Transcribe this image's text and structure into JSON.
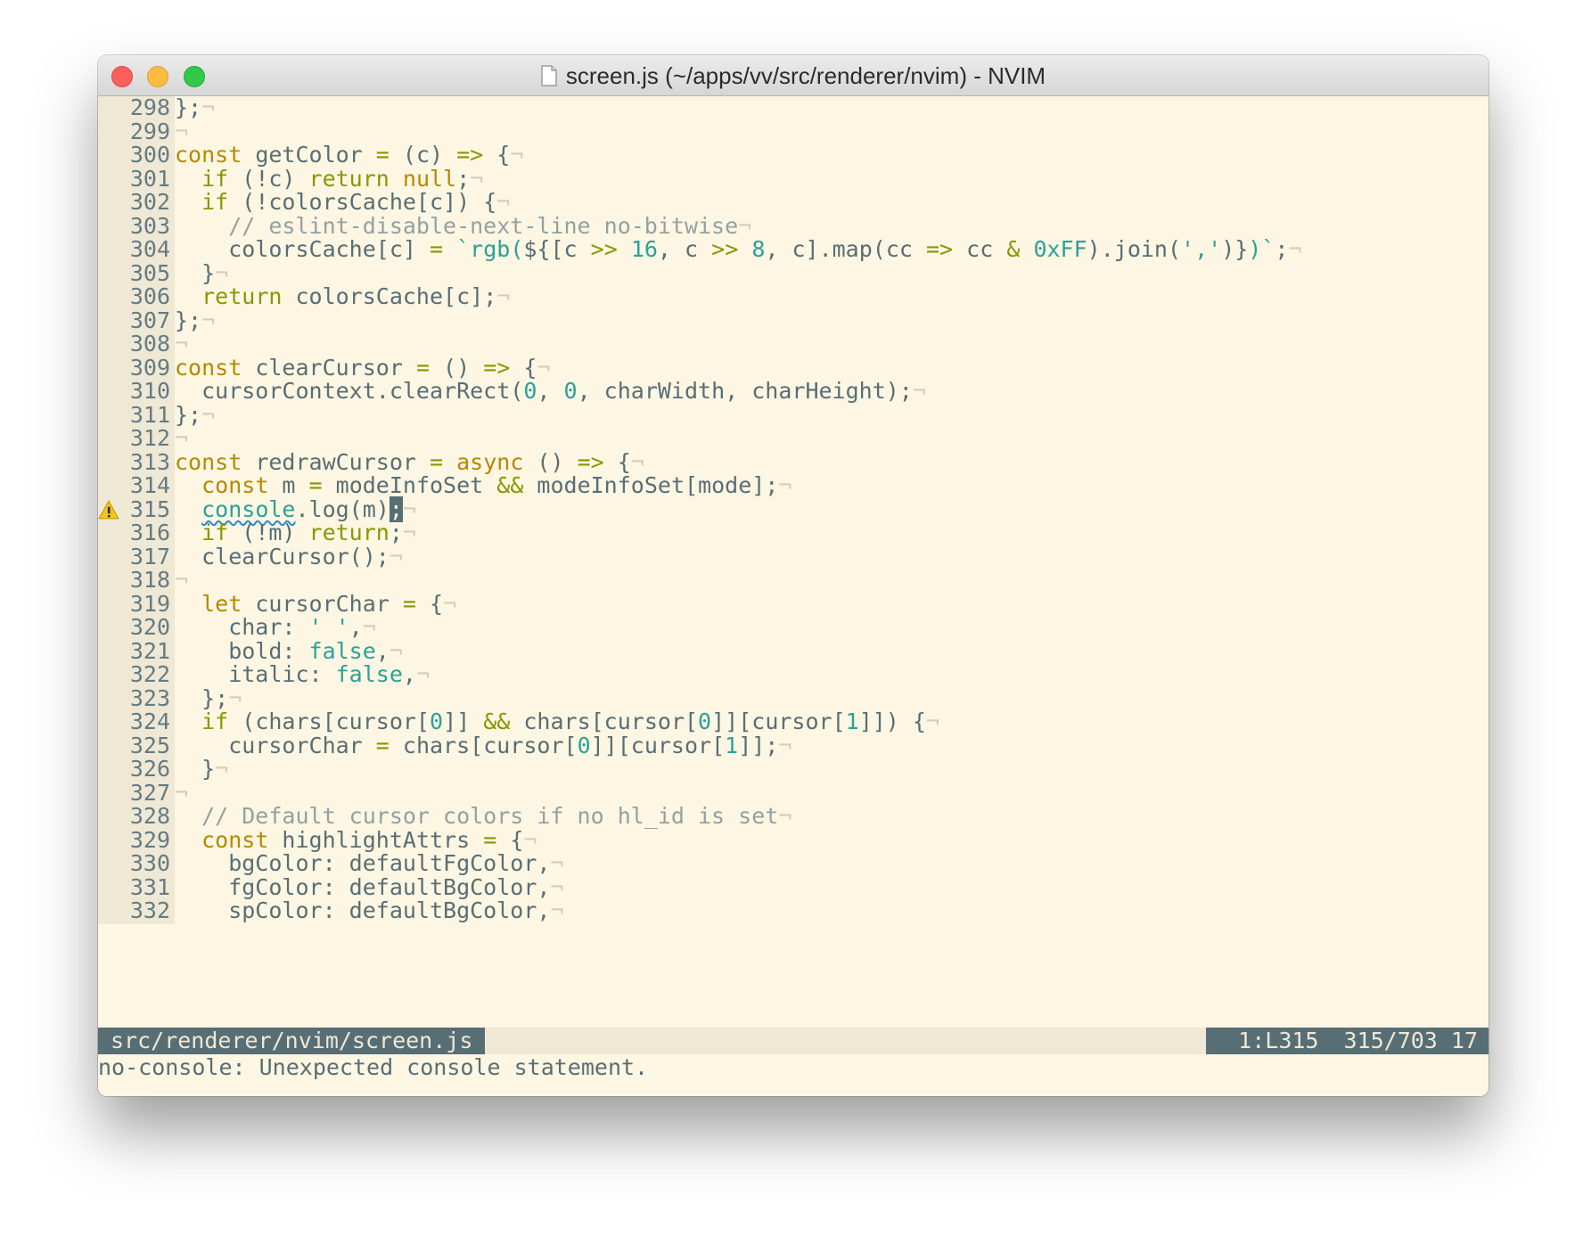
{
  "window": {
    "title": "screen.js (~/apps/vv/src/renderer/nvim) - NVIM"
  },
  "editor": {
    "eol_marker": "¬",
    "lines": [
      {
        "n": "298",
        "t": [
          [
            "};",
            ""
          ]
        ]
      },
      {
        "n": "299",
        "t": []
      },
      {
        "n": "300",
        "t": [
          [
            "const",
            "st"
          ],
          [
            " getColor ",
            ""
          ],
          [
            "=",
            "op"
          ],
          [
            " (c) ",
            ""
          ],
          [
            "=>",
            "op"
          ],
          [
            " {",
            ""
          ]
        ]
      },
      {
        "n": "301",
        "t": [
          [
            "  ",
            ""
          ],
          [
            "if",
            "kw"
          ],
          [
            " (!c) ",
            ""
          ],
          [
            "return",
            "kw"
          ],
          [
            " ",
            ""
          ],
          [
            "null",
            "st"
          ],
          [
            ";",
            ""
          ]
        ]
      },
      {
        "n": "302",
        "t": [
          [
            "  ",
            ""
          ],
          [
            "if",
            "kw"
          ],
          [
            " (!colorsCache[c]) {",
            ""
          ]
        ]
      },
      {
        "n": "303",
        "t": [
          [
            "    // eslint-disable-next-line no-bitwise",
            "cm"
          ]
        ]
      },
      {
        "n": "304",
        "t": [
          [
            "    colorsCache[c] ",
            ""
          ],
          [
            "=",
            "op"
          ],
          [
            " ",
            ""
          ],
          [
            "`rgb(",
            "str"
          ],
          [
            "${",
            ""
          ],
          [
            "[c ",
            ""
          ],
          [
            ">>",
            "op"
          ],
          [
            " ",
            ""
          ],
          [
            "16",
            "num"
          ],
          [
            ", c ",
            ""
          ],
          [
            ">>",
            "op"
          ],
          [
            " ",
            ""
          ],
          [
            "8",
            "num"
          ],
          [
            ", c].map(cc ",
            ""
          ],
          [
            "=>",
            "op"
          ],
          [
            " cc ",
            ""
          ],
          [
            "&",
            "op"
          ],
          [
            " ",
            ""
          ],
          [
            "0xFF",
            "num"
          ],
          [
            ").join(",
            ""
          ],
          [
            "','",
            "str"
          ],
          [
            ")}",
            ""
          ],
          [
            ")`",
            "str"
          ],
          [
            ";",
            ""
          ]
        ]
      },
      {
        "n": "305",
        "t": [
          [
            "  }",
            ""
          ]
        ]
      },
      {
        "n": "306",
        "t": [
          [
            "  ",
            ""
          ],
          [
            "return",
            "kw"
          ],
          [
            " colorsCache[c];",
            ""
          ]
        ]
      },
      {
        "n": "307",
        "t": [
          [
            "};",
            ""
          ]
        ]
      },
      {
        "n": "308",
        "t": []
      },
      {
        "n": "309",
        "t": [
          [
            "const",
            "st"
          ],
          [
            " clearCursor ",
            ""
          ],
          [
            "=",
            "op"
          ],
          [
            " () ",
            ""
          ],
          [
            "=>",
            "op"
          ],
          [
            " {",
            ""
          ]
        ]
      },
      {
        "n": "310",
        "t": [
          [
            "  cursorContext.clearRect(",
            ""
          ],
          [
            "0",
            "num"
          ],
          [
            ", ",
            ""
          ],
          [
            "0",
            "num"
          ],
          [
            ", charWidth, charHeight);",
            ""
          ]
        ]
      },
      {
        "n": "311",
        "t": [
          [
            "};",
            ""
          ]
        ]
      },
      {
        "n": "312",
        "t": []
      },
      {
        "n": "313",
        "t": [
          [
            "const",
            "st"
          ],
          [
            " redrawCursor ",
            ""
          ],
          [
            "=",
            "op"
          ],
          [
            " ",
            ""
          ],
          [
            "async",
            "st"
          ],
          [
            " () ",
            ""
          ],
          [
            "=>",
            "op"
          ],
          [
            " {",
            ""
          ]
        ]
      },
      {
        "n": "314",
        "t": [
          [
            "  ",
            ""
          ],
          [
            "const",
            "st"
          ],
          [
            " m ",
            ""
          ],
          [
            "=",
            "op"
          ],
          [
            " modeInfoSet ",
            ""
          ],
          [
            "&&",
            "op"
          ],
          [
            " modeInfoSet[mode];",
            ""
          ]
        ]
      },
      {
        "n": "315",
        "sign": "warning-sign",
        "t": [
          [
            "  ",
            ""
          ],
          [
            "console",
            "squig"
          ],
          [
            ".log(m)",
            ""
          ],
          [
            ";",
            "cursor"
          ]
        ]
      },
      {
        "n": "316",
        "t": [
          [
            "  ",
            ""
          ],
          [
            "if",
            "kw"
          ],
          [
            " (!m) ",
            ""
          ],
          [
            "return",
            "kw"
          ],
          [
            ";",
            ""
          ]
        ]
      },
      {
        "n": "317",
        "t": [
          [
            "  clearCursor();",
            ""
          ]
        ]
      },
      {
        "n": "318",
        "t": []
      },
      {
        "n": "319",
        "t": [
          [
            "  ",
            ""
          ],
          [
            "let",
            "st"
          ],
          [
            " cursorChar ",
            ""
          ],
          [
            "=",
            "op"
          ],
          [
            " {",
            ""
          ]
        ]
      },
      {
        "n": "320",
        "t": [
          [
            "    char: ",
            ""
          ],
          [
            "' '",
            "str"
          ],
          [
            ",",
            ""
          ]
        ]
      },
      {
        "n": "321",
        "t": [
          [
            "    bold: ",
            ""
          ],
          [
            "false",
            "bool"
          ],
          [
            ",",
            ""
          ]
        ]
      },
      {
        "n": "322",
        "t": [
          [
            "    italic: ",
            ""
          ],
          [
            "false",
            "bool"
          ],
          [
            ",",
            ""
          ]
        ]
      },
      {
        "n": "323",
        "t": [
          [
            "  };",
            ""
          ]
        ]
      },
      {
        "n": "324",
        "t": [
          [
            "  ",
            ""
          ],
          [
            "if",
            "kw"
          ],
          [
            " (chars[cursor[",
            ""
          ],
          [
            "0",
            "num"
          ],
          [
            "]] ",
            ""
          ],
          [
            "&&",
            "op"
          ],
          [
            " chars[cursor[",
            ""
          ],
          [
            "0",
            "num"
          ],
          [
            "]][cursor[",
            ""
          ],
          [
            "1",
            "num"
          ],
          [
            "]]) {",
            ""
          ]
        ]
      },
      {
        "n": "325",
        "t": [
          [
            "    cursorChar ",
            ""
          ],
          [
            "=",
            "op"
          ],
          [
            " chars[cursor[",
            ""
          ],
          [
            "0",
            "num"
          ],
          [
            "]][cursor[",
            ""
          ],
          [
            "1",
            "num"
          ],
          [
            "]];",
            ""
          ]
        ]
      },
      {
        "n": "326",
        "t": [
          [
            "  }",
            ""
          ]
        ]
      },
      {
        "n": "327",
        "t": []
      },
      {
        "n": "328",
        "t": [
          [
            "  // Default cursor colors if no hl_id is set",
            "cm"
          ]
        ]
      },
      {
        "n": "329",
        "t": [
          [
            "  ",
            ""
          ],
          [
            "const",
            "st"
          ],
          [
            " highlightAttrs ",
            ""
          ],
          [
            "=",
            "op"
          ],
          [
            " {",
            ""
          ]
        ]
      },
      {
        "n": "330",
        "t": [
          [
            "    bgColor: defaultFgColor,",
            ""
          ]
        ]
      },
      {
        "n": "331",
        "t": [
          [
            "    fgColor: defaultBgColor,",
            ""
          ]
        ]
      },
      {
        "n": "332",
        "t": [
          [
            "    spColor: defaultBgColor,",
            ""
          ]
        ]
      }
    ]
  },
  "statusline": {
    "file": "src/renderer/nvim/screen.js",
    "warnings": "1:L315",
    "position": "315/703 17"
  },
  "cmdline": {
    "message": "no-console: Unexpected console statement."
  },
  "colors": {
    "background": "#fdf6e3",
    "gutter": "#eee8d5",
    "statusline": "#586e75",
    "keyword_green": "#859900",
    "keyword_yellow": "#b58900",
    "constant_cyan": "#2aa198",
    "comment": "#93a1a1",
    "warning": "#f5c518"
  }
}
